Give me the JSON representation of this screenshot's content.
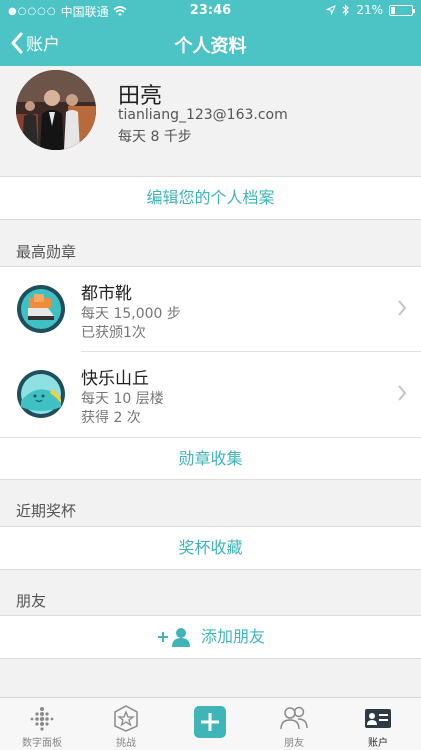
{
  "status": {
    "carrier": "中国联通",
    "time": "23:46",
    "battery": "21%",
    "battery_fraction": 0.21
  },
  "nav": {
    "back_label": "账户",
    "title": "个人资料"
  },
  "profile": {
    "name": "田亮",
    "email": "tianliang_123@163.com",
    "goal": "每天 8 千步",
    "edit_label": "编辑您的个人档案"
  },
  "badges": {
    "section_label": "最高勋章",
    "items": [
      {
        "title": "都市靴",
        "line1": "每天 15,000 步",
        "line2": "已获颁1次"
      },
      {
        "title": "快乐山丘",
        "line1": "每天 10 层楼",
        "line2": "获得 2 次"
      }
    ],
    "collection_label": "勋章收集"
  },
  "trophies": {
    "section_label": "近期奖杯",
    "collection_label": "奖杯收藏"
  },
  "friends": {
    "section_label": "朋友",
    "add_label": "添加朋友"
  },
  "tabbar": {
    "items": [
      {
        "label": "数字面板",
        "icon": "dashboard-icon"
      },
      {
        "label": "挑战",
        "icon": "challenge-icon"
      },
      {
        "label": "",
        "icon": "plus-icon"
      },
      {
        "label": "朋友",
        "icon": "friends-icon"
      },
      {
        "label": "账户",
        "icon": "account-icon"
      }
    ]
  },
  "colors": {
    "accent": "#4cc3c4",
    "link": "#3fb5b8"
  }
}
